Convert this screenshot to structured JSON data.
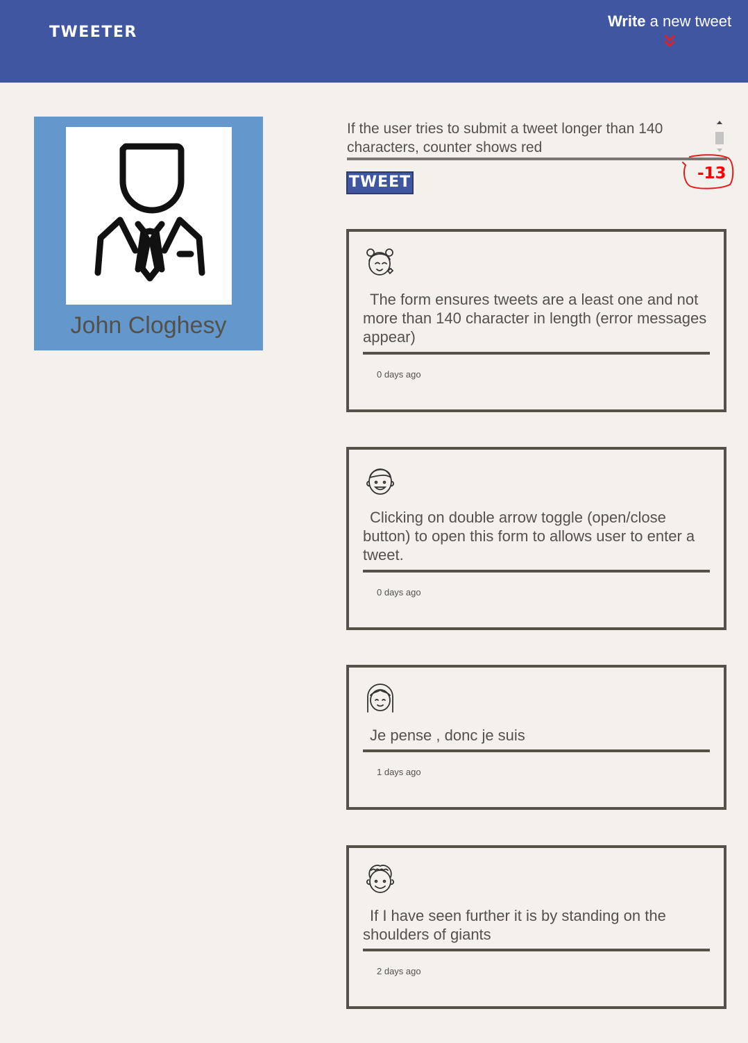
{
  "nav": {
    "brand": "TWEETER",
    "write_bold": "Write",
    "write_rest": " a new tweet",
    "toggle_icon": "double-chevron-down-icon",
    "toggle_color": "#e0202a",
    "background": "#4056a1"
  },
  "profile": {
    "name": "John Cloghesy",
    "avatar_icon": "businessman-avatar-icon",
    "background": "#6497cc"
  },
  "compose": {
    "text": "If the user tries to submit a tweet longer than 140 characters, counter shows red",
    "button_label": "TWEET",
    "counter": "-13",
    "counter_color": "#ff0000"
  },
  "tweets": [
    {
      "avatar_icon": "girl-avatar-icon",
      "text": "The form ensures tweets are a least one and not more than 140 character in length (error messages appear)",
      "time": "0 days ago"
    },
    {
      "avatar_icon": "boy-avatar-icon",
      "text": "Clicking on double arrow toggle (open/close button) to open this form to allows user to enter a tweet.",
      "time": "0 days ago"
    },
    {
      "avatar_icon": "girl-bangs-avatar-icon",
      "text": "Je pense , donc je suis",
      "time": "1 days ago"
    },
    {
      "avatar_icon": "curly-hair-avatar-icon",
      "text": "If I have seen further it is by standing on the shoulders of giants",
      "time": "2 days ago"
    }
  ]
}
